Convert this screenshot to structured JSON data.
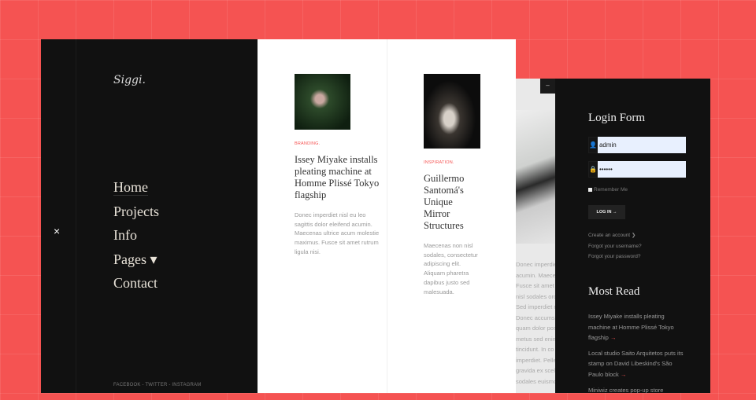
{
  "menu": {
    "logo": "Siggi.",
    "close_icon": "×",
    "items": [
      {
        "label": "Home"
      },
      {
        "label": "Projects"
      },
      {
        "label": "Info"
      },
      {
        "label": "Pages ▾"
      },
      {
        "label": "Contact"
      }
    ],
    "social": "FACEBOOK - TWITTER - INSTAGRAM"
  },
  "articles": [
    {
      "category": "BRANDING.",
      "title": "Issey Miyake installs pleating machine at Homme Plissé Tokyo flagship",
      "text": "Donec imperdiet nisl eu leo sagittis dolor eleifend acumin. Maecenas ultrice acum molestie maximus. Fusce sit amet rutrum ligula nisi."
    },
    {
      "category": "INSPIRATION.",
      "title": "Guillermo Santomá's Unique Mirror Structures",
      "text": "Maecenas non nisl sodales, consectetur adipiscing elit. Aliquam pharetra dapibus justo sed malesuada."
    }
  ],
  "background_article": {
    "lines": [
      "Donec imperdiet",
      "acumin. Maecenas",
      "Fusce sit amet",
      "nisl sodales orci",
      "Sed imperdiet r",
      "Donec accumsan",
      "quam dolor pos",
      "metus sed enim",
      "tincidunt. In co",
      "imperdiet. Pelle",
      "gravida ex scele",
      "sodales euismo"
    ],
    "minimize_label": "–"
  },
  "login": {
    "title": "Login Form",
    "username": "admin",
    "password": "••••••",
    "remember": "Remember Me",
    "button": "LOG IN →",
    "links": [
      "Create an account ❯",
      "Forgot your username?",
      "Forgot your password?"
    ]
  },
  "most_read": {
    "title": "Most Read",
    "items": [
      {
        "text": "Issey Miyake installs pleating machine at Homme Plissé Tokyo flagship",
        "arrow": "→"
      },
      {
        "text": "Local studio Saito Arquitetos puts its stamp on David Libeskind's São Paulo block",
        "arrow": "→"
      },
      {
        "text": "Miniwiz creates pop-up store",
        "arrow": ""
      }
    ]
  },
  "colors": {
    "accent": "#f55352",
    "panel": "#111111"
  }
}
